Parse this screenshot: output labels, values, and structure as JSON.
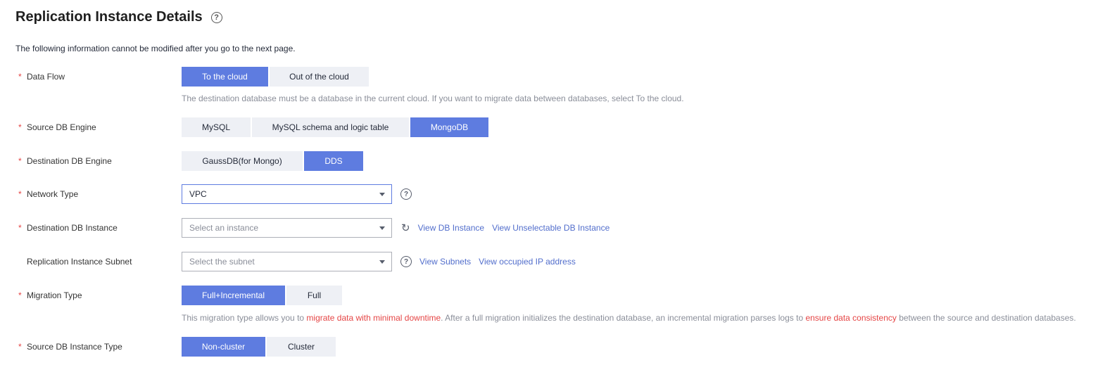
{
  "header": {
    "title": "Replication Instance Details",
    "note": "The following information cannot be modified after you go to the next page."
  },
  "required_mark": "*",
  "data_flow": {
    "label": "Data Flow",
    "options": [
      "To the cloud",
      "Out of the cloud"
    ],
    "selected": "To the cloud",
    "hint": "The destination database must be a database in the current cloud. If you want to migrate data between databases, select To the cloud."
  },
  "source_engine": {
    "label": "Source DB Engine",
    "options": [
      "MySQL",
      "MySQL schema and logic table",
      "MongoDB"
    ],
    "selected": "MongoDB"
  },
  "dest_engine": {
    "label": "Destination DB Engine",
    "options": [
      "GaussDB(for Mongo)",
      "DDS"
    ],
    "selected": "DDS"
  },
  "network_type": {
    "label": "Network Type",
    "value": "VPC",
    "help_icon": "question-circle-icon"
  },
  "dest_instance": {
    "label": "Destination DB Instance",
    "placeholder": "Select an instance",
    "refresh_icon": "refresh-icon",
    "link_view": "View DB Instance",
    "link_unselectable": "View Unselectable DB Instance"
  },
  "subnet": {
    "label": "Replication Instance Subnet",
    "placeholder": "Select the subnet",
    "link_subnets": "View Subnets",
    "link_occupied": "View occupied IP address"
  },
  "migration_type": {
    "label": "Migration Type",
    "options": [
      "Full+Incremental",
      "Full"
    ],
    "selected": "Full+Incremental",
    "hint_1": "This migration type allows you to ",
    "hint_red_1": "migrate data with minimal downtime",
    "hint_2": ". After a full migration initializes the destination database, an incremental migration parses logs to ",
    "hint_red_2": "ensure data consistency",
    "hint_3": " between the source and destination databases."
  },
  "source_instance_type": {
    "label": "Source DB Instance Type",
    "options": [
      "Non-cluster",
      "Cluster"
    ],
    "selected": "Non-cluster"
  },
  "colors": {
    "accent": "#5e7ce0",
    "link": "#526ecc",
    "required": "#e54545",
    "option_bg": "#eef0f5",
    "hint_text": "#8a8e99"
  }
}
